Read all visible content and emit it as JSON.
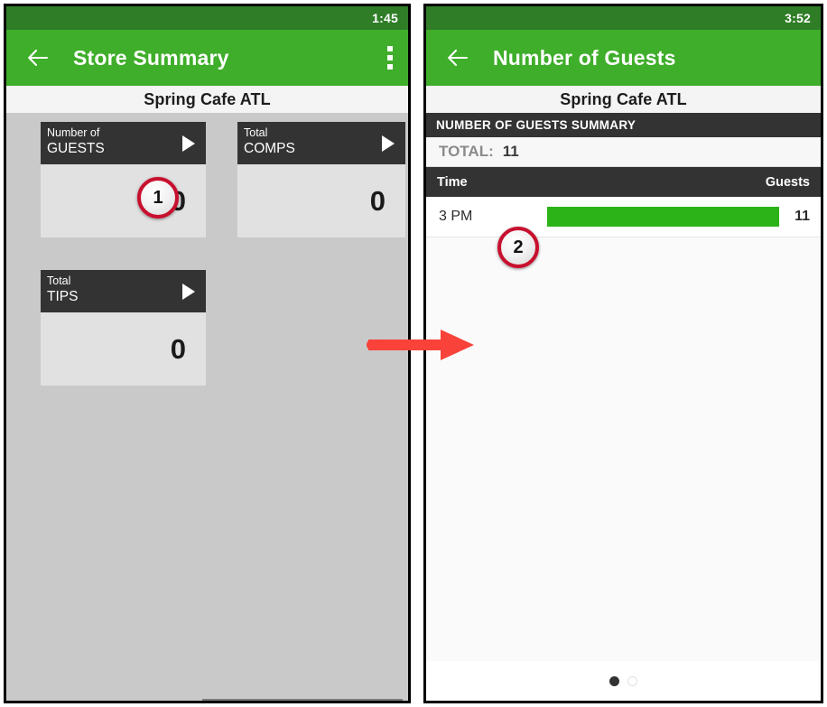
{
  "left_panel": {
    "status_bar": {
      "clock": "1:45"
    },
    "app_bar": {
      "back_icon": "arrow-left-icon",
      "title": "Store Summary",
      "overflow_icon": "more-vertical-icon"
    },
    "store_name": "Spring Cafe ATL",
    "cards": [
      {
        "line1": "Number of",
        "line2": "GUESTS",
        "value": "0",
        "chevron_icon": "play-triangle-icon"
      },
      {
        "line1": "Total",
        "line2": "COMPS",
        "value": "0",
        "chevron_icon": "play-triangle-icon"
      },
      {
        "line1": "Total",
        "line2": "TIPS",
        "value": "0",
        "chevron_icon": "play-triangle-icon"
      }
    ]
  },
  "right_panel": {
    "status_bar": {
      "clock": "3:52"
    },
    "app_bar": {
      "back_icon": "arrow-left-icon",
      "title": "Number of Guests"
    },
    "store_name": "Spring Cafe ATL",
    "section_header": "NUMBER OF GUESTS SUMMARY",
    "total": {
      "label": "TOTAL:",
      "value": "11"
    },
    "table": {
      "columns": [
        "Time",
        "Guests"
      ],
      "rows": [
        {
          "time": "3 PM",
          "guests": "11",
          "bar_pct": 100
        }
      ]
    },
    "pager": {
      "dots": 2,
      "active": 0
    }
  },
  "annotations": {
    "badges": [
      {
        "label": "1"
      },
      {
        "label": "2"
      }
    ],
    "arrow_icon": "red-right-arrow-icon"
  },
  "colors": {
    "status_bar_green": "#2f7d27",
    "app_bar_green": "#3fae2a",
    "bar_green": "#2cb317",
    "card_header_dark": "#333333",
    "card_body_gray": "#e1e1e1",
    "page_gray": "#c9c9c9",
    "badge_red": "#c8102e",
    "arrow_red": "#f9423a"
  }
}
